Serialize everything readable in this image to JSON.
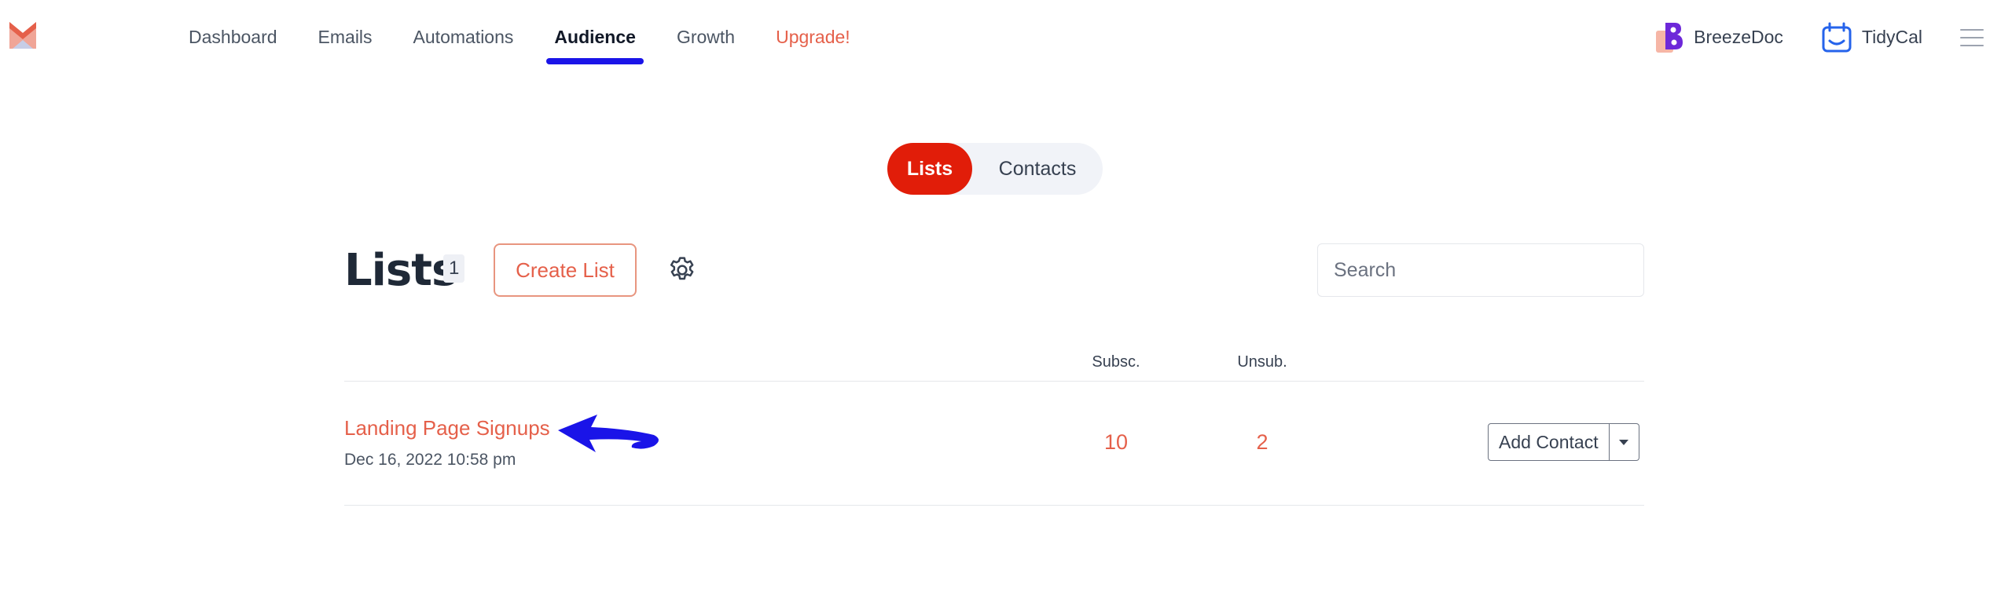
{
  "nav": {
    "items": [
      {
        "label": "Dashboard"
      },
      {
        "label": "Emails"
      },
      {
        "label": "Automations"
      },
      {
        "label": "Audience"
      },
      {
        "label": "Growth"
      },
      {
        "label": "Upgrade!"
      }
    ],
    "active": "Audience"
  },
  "apps": {
    "breezedoc": "BreezeDoc",
    "tidycal": "TidyCal"
  },
  "toggle": {
    "lists": "Lists",
    "contacts": "Contacts",
    "active": "Lists"
  },
  "page": {
    "title": "Lists",
    "count": "1",
    "create_label": "Create List",
    "search_placeholder": "Search"
  },
  "table": {
    "columns": [
      "Subsc.",
      "Unsub."
    ],
    "rows": [
      {
        "name": "Landing Page Signups",
        "date": "Dec 16, 2022 10:58 pm",
        "subscribed": "10",
        "unsubscribed": "2",
        "action_label": "Add Contact"
      }
    ]
  },
  "colors": {
    "accent": "#e5604a",
    "toggle_active": "#e11d09",
    "nav_underline": "#1a14e8",
    "annotation_arrow": "#1a14e8"
  },
  "icons": [
    "brand-logo-icon",
    "breezedoc-icon",
    "tidycal-icon",
    "hamburger-menu-icon",
    "gear-icon",
    "caret-down-icon",
    "annotation-arrow-icon"
  ]
}
